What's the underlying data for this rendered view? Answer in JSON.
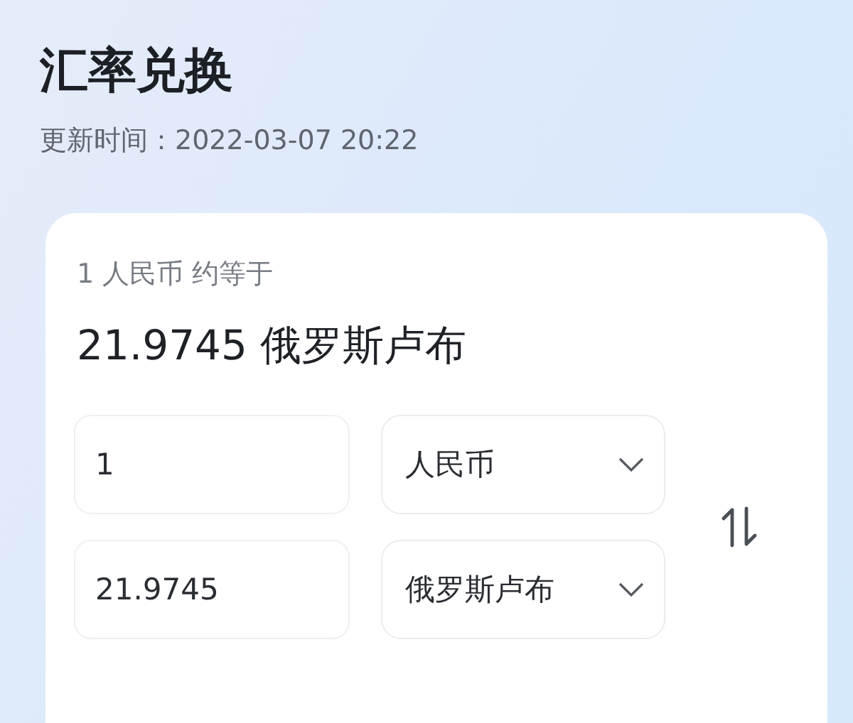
{
  "title": "汇率兑换",
  "updated": "更新时间：2022-03-07 20:22",
  "card": {
    "rate_label": "1 人民币 约等于",
    "rate_result": "21.9745 俄罗斯卢布",
    "rows": [
      {
        "amount": "1",
        "currency": "人民币"
      },
      {
        "amount": "21.9745",
        "currency": "俄罗斯卢布"
      }
    ]
  }
}
